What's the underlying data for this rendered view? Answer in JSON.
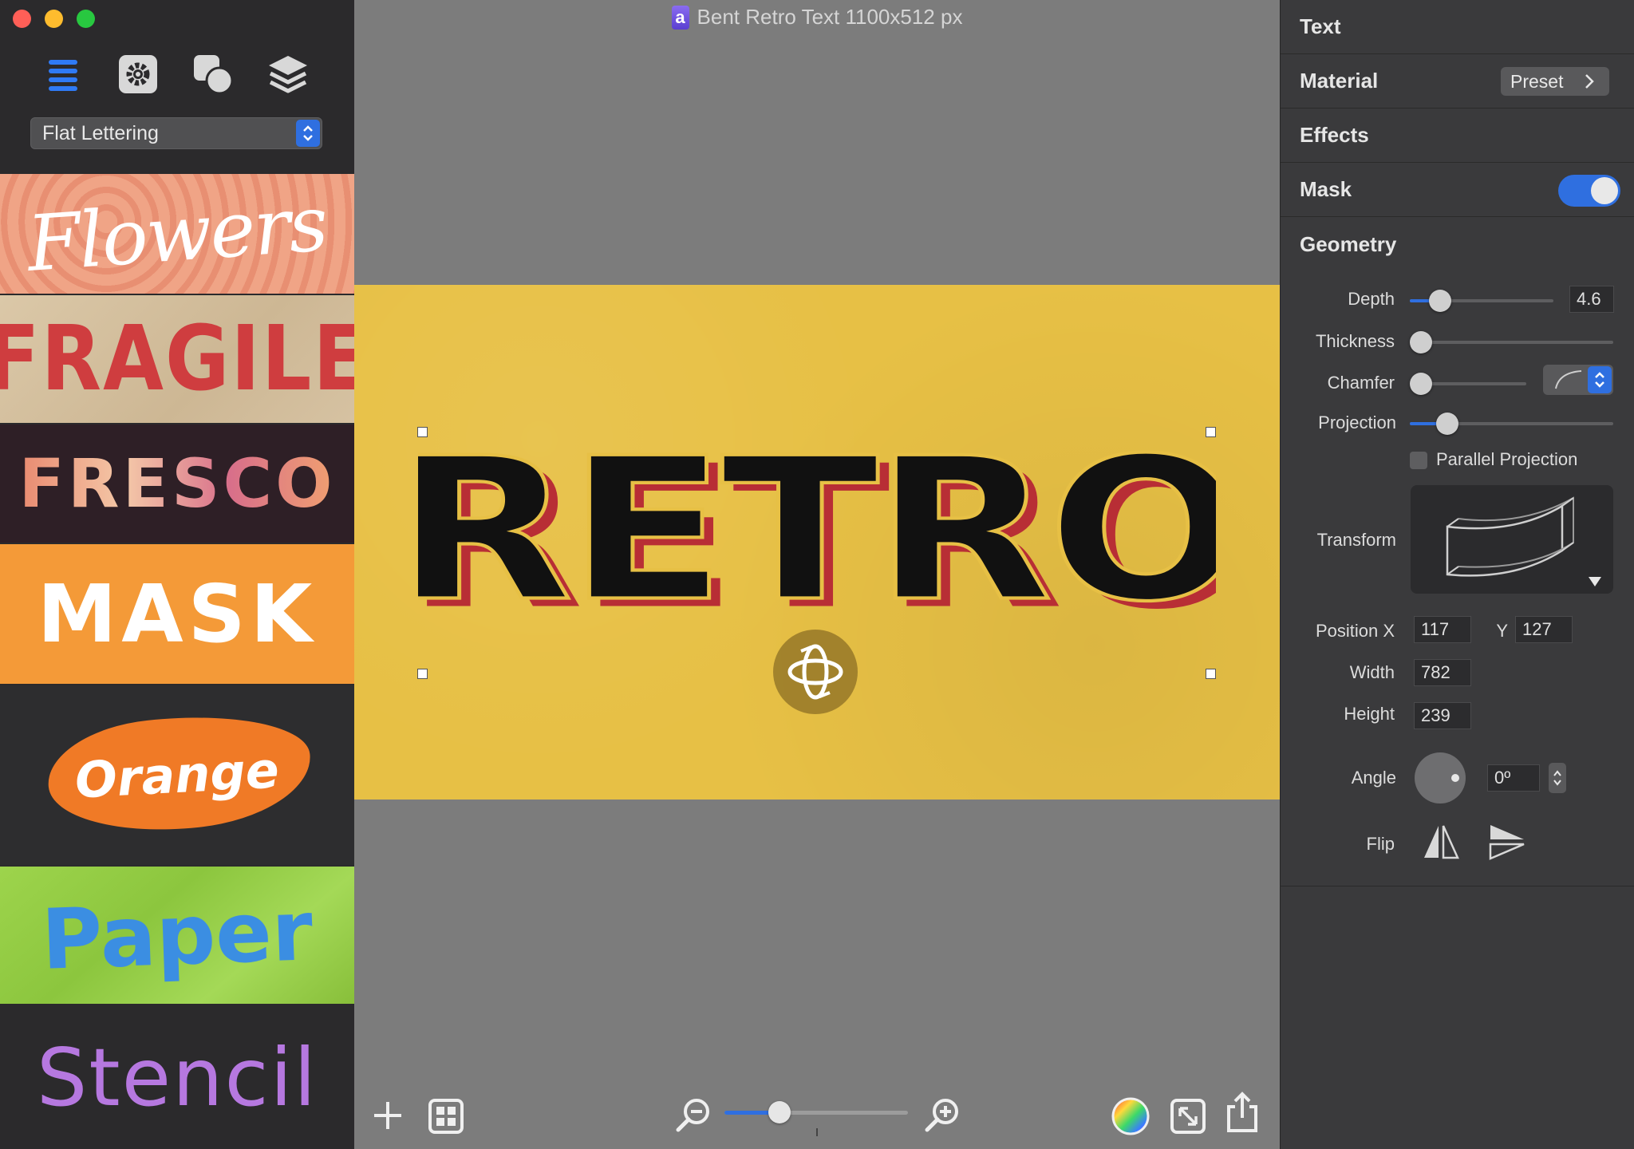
{
  "window": {
    "title": "Bent Retro Text 1100x512 px",
    "doc_icon": "a"
  },
  "sidebar": {
    "toolbar": [
      {
        "name": "list-icon"
      },
      {
        "name": "gear-icon"
      },
      {
        "name": "shapes-icon"
      },
      {
        "name": "layers-icon"
      }
    ],
    "style_select": {
      "value": "Flat Lettering"
    },
    "presets": [
      {
        "label": "Flowers"
      },
      {
        "label": "FRAGILE"
      },
      {
        "label": "FRESCO"
      },
      {
        "label": "MASK"
      },
      {
        "label": "Orange"
      },
      {
        "label": "Paper"
      },
      {
        "label": "Stencil"
      }
    ]
  },
  "canvas": {
    "artwork_text": "RETRO",
    "background_color": "#e7c045",
    "zoom_level": 0.3
  },
  "inspector": {
    "sections": {
      "text": "Text",
      "material": "Material",
      "effects": "Effects",
      "mask": "Mask",
      "geometry": "Geometry"
    },
    "preset_button": "Preset",
    "mask_enabled": true,
    "geometry": {
      "depth": {
        "label": "Depth",
        "value": "4.6",
        "level": 0.2
      },
      "thickness": {
        "label": "Thickness",
        "level": 0.0
      },
      "chamfer": {
        "label": "Chamfer",
        "level": 0.0
      },
      "projection": {
        "label": "Projection",
        "level": 0.18
      },
      "parallel_projection": {
        "label": "Parallel Projection",
        "checked": false
      },
      "transform": {
        "label": "Transform"
      },
      "position_x": {
        "label": "Position X",
        "value": "117"
      },
      "position_y": {
        "label": "Y",
        "value": "127"
      },
      "width": {
        "label": "Width",
        "value": "782"
      },
      "height": {
        "label": "Height",
        "value": "239"
      },
      "angle": {
        "label": "Angle",
        "value": "0º"
      },
      "flip": {
        "label": "Flip"
      }
    }
  },
  "colors": {
    "accent": "#2f6fe0",
    "retro_red": "#b82e35",
    "retro_black": "#111111"
  }
}
